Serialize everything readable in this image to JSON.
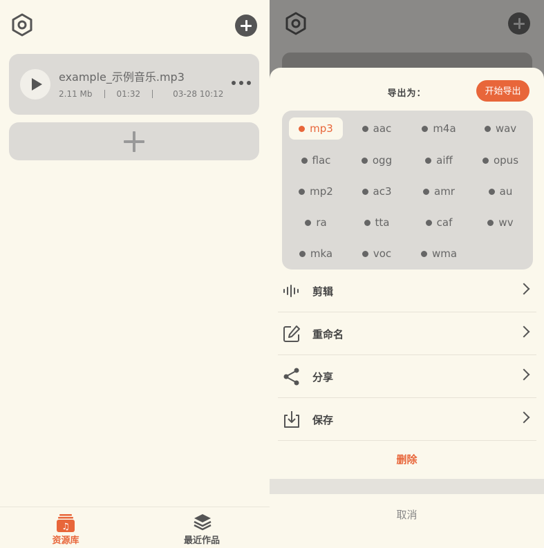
{
  "colors": {
    "accent": "#e8663a",
    "card": "#dcdad6",
    "bg": "#fbf8ec"
  },
  "left": {
    "file": {
      "name": "example_示例音乐.mp3",
      "size": "2.11 Mb",
      "duration": "01:32",
      "date": "03-28 10:12"
    },
    "nav": {
      "library_label": "资源库",
      "recent_label": "最近作品"
    }
  },
  "sheet": {
    "export_title": "导出为：",
    "start_export": "开始导出",
    "formats": [
      "mp3",
      "aac",
      "m4a",
      "wav",
      "flac",
      "ogg",
      "aiff",
      "opus",
      "mp2",
      "ac3",
      "amr",
      "au",
      "ra",
      "tta",
      "caf",
      "wv",
      "mka",
      "voc",
      "wma"
    ],
    "selected_format": "mp3",
    "menu": {
      "edit": "剪辑",
      "rename": "重命名",
      "share": "分享",
      "save": "保存"
    },
    "delete": "删除",
    "cancel": "取消"
  }
}
